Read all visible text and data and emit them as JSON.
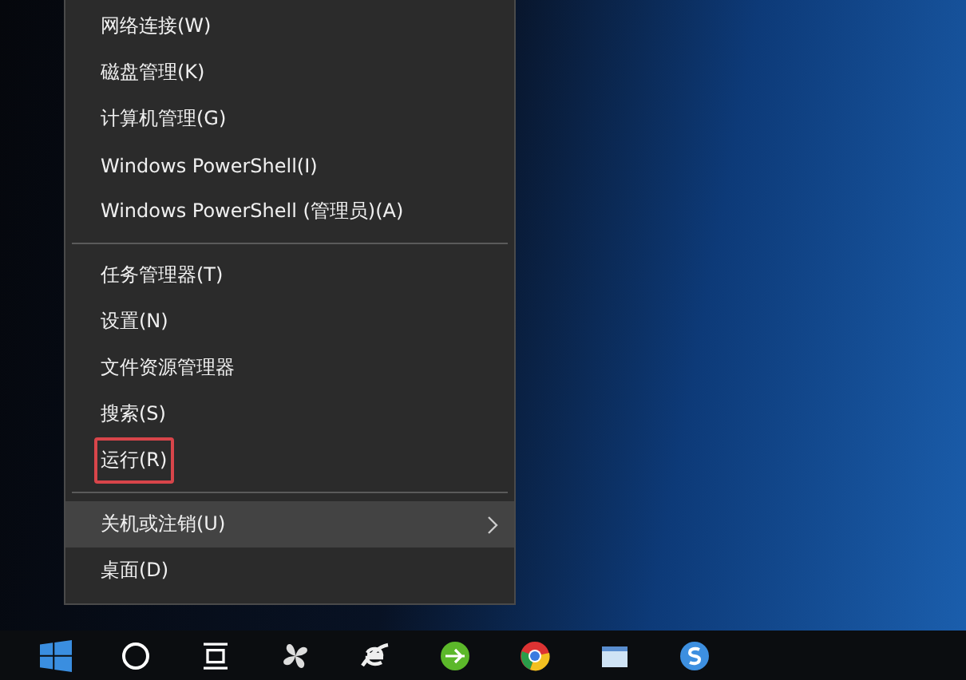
{
  "context_menu": {
    "items": [
      {
        "kind": "item",
        "label": "网络连接(W)",
        "selected": false,
        "annotated": false,
        "has_submenu": false
      },
      {
        "kind": "item",
        "label": "磁盘管理(K)",
        "selected": false,
        "annotated": false,
        "has_submenu": false
      },
      {
        "kind": "item",
        "label": "计算机管理(G)",
        "selected": false,
        "annotated": false,
        "has_submenu": false
      },
      {
        "kind": "item",
        "label": "Windows PowerShell(I)",
        "selected": false,
        "annotated": false,
        "has_submenu": false
      },
      {
        "kind": "item",
        "label": "Windows PowerShell (管理员)(A)",
        "selected": false,
        "annotated": false,
        "has_submenu": false
      },
      {
        "kind": "separator"
      },
      {
        "kind": "item",
        "label": "任务管理器(T)",
        "selected": false,
        "annotated": false,
        "has_submenu": false
      },
      {
        "kind": "item",
        "label": "设置(N)",
        "selected": false,
        "annotated": false,
        "has_submenu": false
      },
      {
        "kind": "item",
        "label": "文件资源管理器",
        "selected": false,
        "annotated": false,
        "has_submenu": false
      },
      {
        "kind": "item",
        "label": "搜索(S)",
        "selected": false,
        "annotated": false,
        "has_submenu": false
      },
      {
        "kind": "item",
        "label": "运行(R)",
        "selected": false,
        "annotated": true,
        "has_submenu": false
      },
      {
        "kind": "separator"
      },
      {
        "kind": "item",
        "label": "关机或注销(U)",
        "selected": true,
        "annotated": false,
        "has_submenu": true
      },
      {
        "kind": "item",
        "label": "桌面(D)",
        "selected": false,
        "annotated": false,
        "has_submenu": false
      }
    ]
  },
  "taskbar": {
    "icons": [
      {
        "kind": "start"
      },
      {
        "kind": "search"
      },
      {
        "kind": "taskview"
      },
      {
        "kind": "pinwheel"
      },
      {
        "kind": "ie"
      },
      {
        "kind": "green-browser"
      },
      {
        "kind": "chrome"
      },
      {
        "kind": "window"
      },
      {
        "kind": "sogou"
      }
    ]
  }
}
